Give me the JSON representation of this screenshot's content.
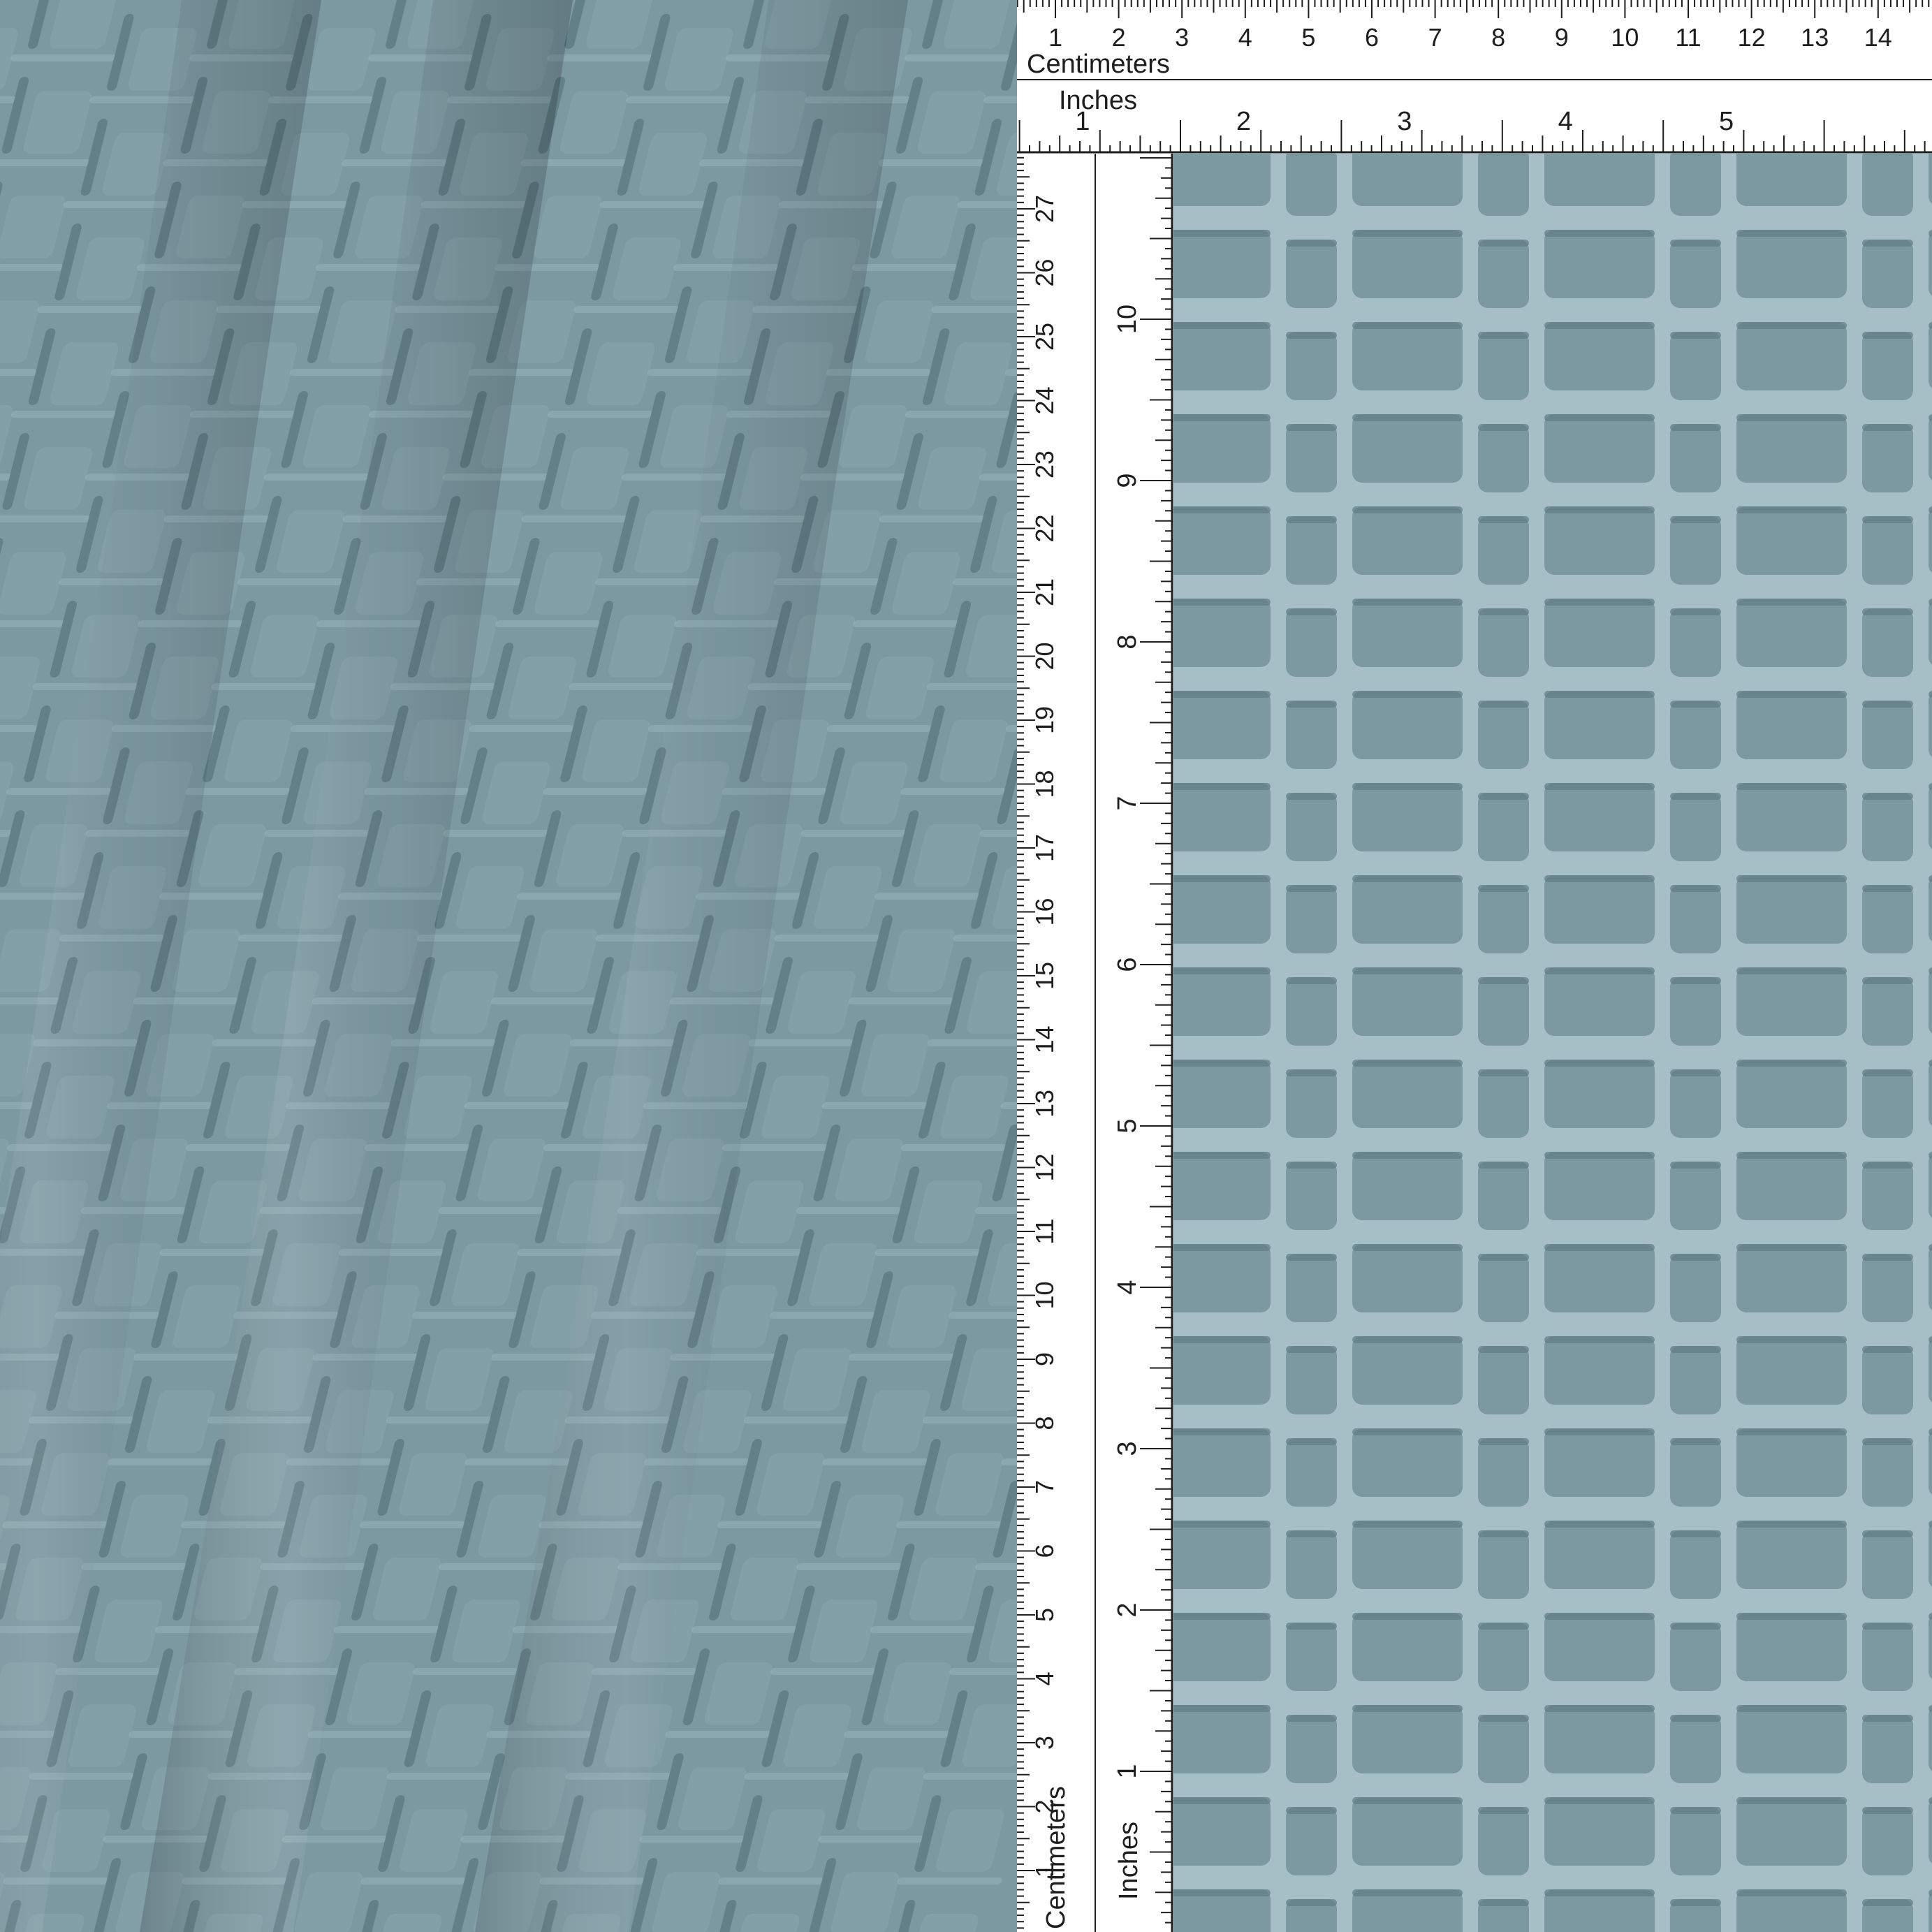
{
  "scene": {
    "subject": "blue-grey waffle knit fabric",
    "colors": {
      "fabric_base": "#7c99a2",
      "fabric_shadow": "#5f7a84",
      "fabric_highlight": "#a6bfc6",
      "ruler_bg": "#ffffff",
      "ruler_ink": "#1e1e1e"
    }
  },
  "ruler": {
    "top": {
      "cm_label": "Centimeters",
      "in_label": "Inches",
      "cm_numbers": [
        "1",
        "2",
        "3",
        "4",
        "5",
        "6",
        "7",
        "8",
        "9",
        "10",
        "11",
        "12",
        "13",
        "14"
      ],
      "in_numbers": [
        "1",
        "2",
        "3",
        "4",
        "5"
      ]
    },
    "left": {
      "cm_label": "Centimeters",
      "in_label": "Inches",
      "cm_numbers": [
        "1",
        "2",
        "3",
        "4",
        "5",
        "6",
        "7",
        "8",
        "9",
        "10",
        "11",
        "12",
        "13",
        "14",
        "15",
        "16",
        "17",
        "18",
        "19",
        "20",
        "21",
        "22",
        "23",
        "24",
        "25",
        "26",
        "27"
      ],
      "in_numbers": [
        "1",
        "2",
        "3",
        "4",
        "5",
        "6",
        "7",
        "8",
        "9",
        "10"
      ]
    }
  }
}
